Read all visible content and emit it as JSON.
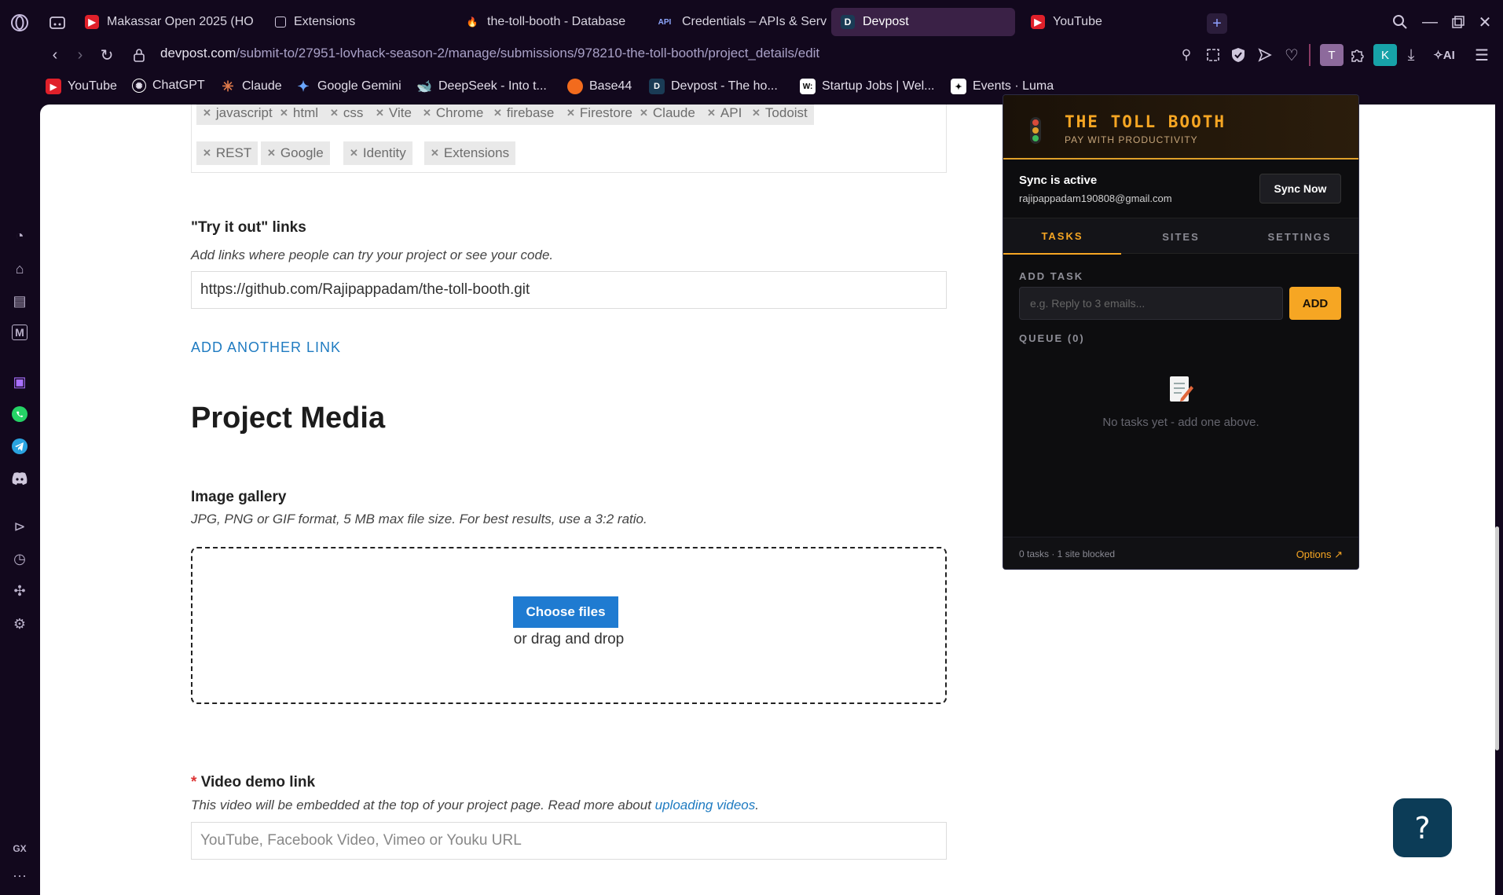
{
  "tabs": [
    {
      "label": "Makassar Open 2025 (HO",
      "icon": "youtube-icon"
    },
    {
      "label": "Extensions",
      "icon": "extensions-icon"
    },
    {
      "label": "the-toll-booth - Database",
      "icon": "firebase-icon"
    },
    {
      "label": "Credentials – APIs & Servic",
      "icon": "api-icon"
    },
    {
      "label": "Devpost",
      "icon": "devpost-icon"
    },
    {
      "label": "YouTube",
      "icon": "youtube-icon"
    }
  ],
  "address": {
    "host": "devpost.com",
    "path": "/submit-to/27951-lovhack-season-2/manage/submissions/978210-the-toll-booth/project_details/edit"
  },
  "bookmarks": [
    "YouTube",
    "ChatGPT",
    "Claude",
    "Google Gemini",
    "DeepSeek - Into t...",
    "Base44",
    "Devpost - The ho...",
    "Startup Jobs | Wel...",
    "Events · Luma"
  ],
  "toolbar": {
    "ai_label": "AI",
    "profile_t": "T",
    "profile_k": "K"
  },
  "sidebar": {
    "gx_label": "GX",
    "more_label": "···"
  },
  "tags": [
    "javascript",
    "html",
    "css",
    "Vite",
    "Chrome",
    "firebase",
    "Firestore",
    "Claude",
    "API",
    "Todoist",
    "REST",
    "Google",
    "Identity",
    "Extensions"
  ],
  "try_links": {
    "title": "\"Try it out\" links",
    "help": "Add links where people can try your project or see your code.",
    "value": "https://github.com/Rajipappadam/the-toll-booth.git",
    "add_another": "ADD ANOTHER LINK"
  },
  "media": {
    "section_title": "Project Media",
    "gallery_title": "Image gallery",
    "gallery_help": "JPG, PNG or GIF format, 5 MB max file size. For best results, use a 3:2 ratio.",
    "choose_files": "Choose files",
    "drag_drop": "or drag and drop"
  },
  "video": {
    "required_mark": "*",
    "title": "Video demo link",
    "help_prefix": "This video will be embedded at the top of your project page. Read more about ",
    "help_link": "uploading videos",
    "help_suffix": ".",
    "placeholder": "YouTube, Facebook Video, Vimeo or Youku URL"
  },
  "help_button": "?",
  "popup": {
    "brand": "THE TOLL BOOTH",
    "tagline": "PAY WITH PRODUCTIVITY",
    "sync_title": "Sync is active",
    "sync_email": "rajipappadam190808@gmail.com",
    "sync_button": "Sync Now",
    "tabs": [
      "TASKS",
      "SITES",
      "SETTINGS"
    ],
    "add_task_label": "ADD TASK",
    "task_placeholder": "e.g. Reply to 3 emails...",
    "add_button": "ADD",
    "queue_label": "QUEUE (0)",
    "empty_text": "No tasks yet - add one above.",
    "footer_status": "0 tasks · 1 site blocked",
    "footer_options": "Options ↗",
    "accent": "#f6a623"
  }
}
